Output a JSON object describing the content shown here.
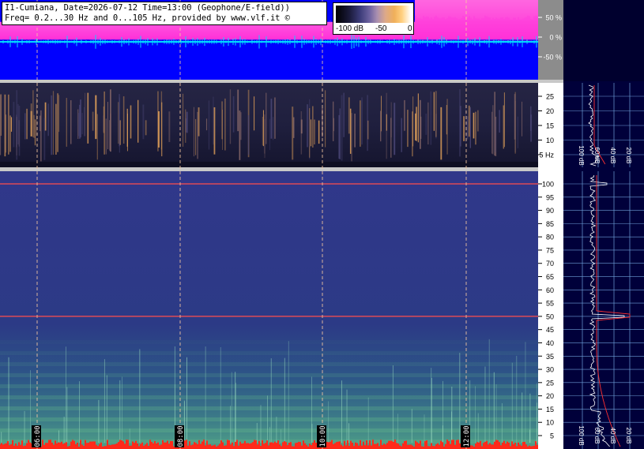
{
  "caption": {
    "line1": "I1-Cumiana, Date=2026-07-12 Time=13:00 (Geophone/E-field))",
    "line2": "Freq= 0.2...30 Hz and 0...105 Hz, provided by www.vlf.it ©"
  },
  "colorbar": {
    "labels": [
      "-100 dB",
      "-50",
      "0"
    ]
  },
  "colors": {
    "waveform_bg": "#0000ff",
    "waveform_trace": "#00d8ff",
    "waveform_envelope": "#ff33dd",
    "spectrogram_low": "#20234e",
    "spectrogram_high": "#ffb347",
    "spectrum_bg": "#00003a",
    "gridline": "#6fa0d8",
    "hum_line": "#ff4d4d",
    "time_marker": "#f5c8a0",
    "axis_panel": "#ffffff"
  },
  "chart_data": [
    {
      "type": "line",
      "panel": "waveform",
      "yticklabels": [
        "50 %",
        "0 %",
        "-50 %"
      ],
      "y_ticks": [
        50,
        0,
        -50
      ],
      "ylim": [
        -100,
        100
      ]
    },
    {
      "type": "heatmap",
      "panel": "spectrogram-0.2-30Hz",
      "y_unit": "Hz",
      "yticklabels": [
        "25",
        "20",
        "15",
        "10",
        "5 Hz"
      ],
      "y_ticks": [
        25,
        20,
        15,
        10,
        5
      ],
      "ylim": [
        0.2,
        30
      ]
    },
    {
      "type": "heatmap",
      "panel": "spectrogram-0-105Hz",
      "yticklabels": [
        "100",
        "95",
        "90",
        "85",
        "80",
        "75",
        "70",
        "65",
        "60",
        "55",
        "50",
        "45",
        "40",
        "35",
        "30",
        "25",
        "20",
        "15",
        "10",
        "5"
      ],
      "y_ticks": [
        100,
        95,
        90,
        85,
        80,
        75,
        70,
        65,
        60,
        55,
        50,
        45,
        40,
        35,
        30,
        25,
        20,
        15,
        10,
        5
      ],
      "ylim": [
        0,
        105
      ],
      "xticklabels": [
        "06:00",
        "08:00",
        "10:00",
        "12:00"
      ],
      "x_ticks": [
        "06:00",
        "08:00",
        "10:00",
        "12:00"
      ],
      "highlighted_lines_hz": [
        50,
        100
      ]
    },
    {
      "type": "line",
      "panel": "spectrum-low",
      "xticklabels": [
        "100 dB",
        "60 dB",
        "40 dB",
        "20 dB"
      ],
      "ylim": [
        0.2,
        30
      ]
    },
    {
      "type": "line",
      "panel": "spectrum-high",
      "xticklabels": [
        "100 dB",
        "60 dB",
        "40 dB",
        "20 dB"
      ],
      "ylim": [
        0,
        105
      ],
      "peaks_hz": [
        50,
        100
      ]
    }
  ]
}
